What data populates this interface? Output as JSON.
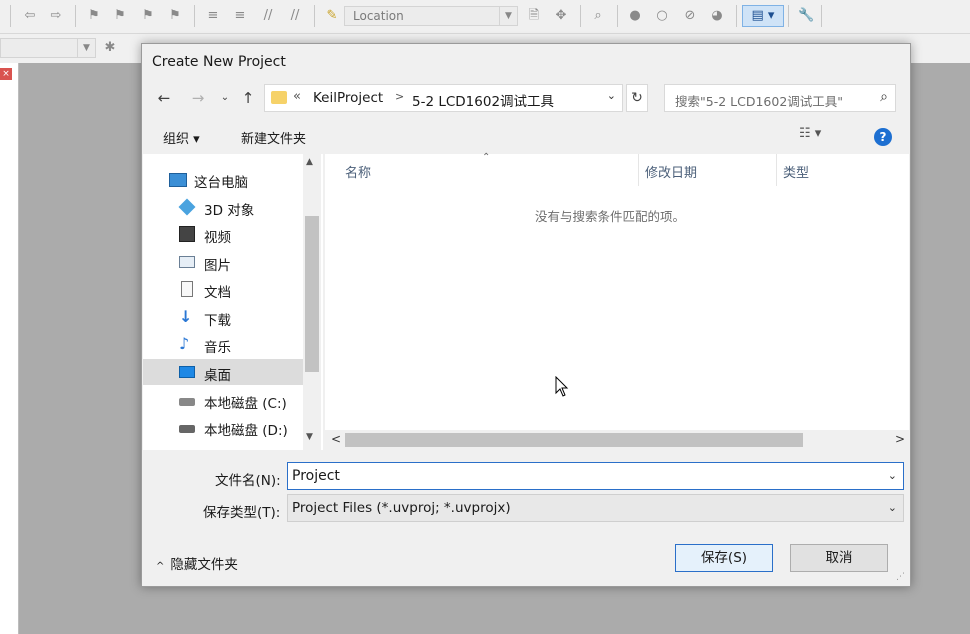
{
  "ide": {
    "location_placeholder": "Location"
  },
  "dialog": {
    "title": "Create New Project",
    "address": {
      "chevron": "«",
      "crumbs": [
        "KeilProject",
        "5-2 LCD1602调试工具"
      ]
    },
    "search_placeholder": "搜索\"5-2 LCD1602调试工具\"",
    "commands": {
      "organize": "组织 ▾",
      "new_folder": "新建文件夹"
    },
    "nav_items": [
      {
        "label": "这台电脑",
        "icon": "computer-icon"
      },
      {
        "label": "3D 对象",
        "icon": "3d-objects-icon"
      },
      {
        "label": "视频",
        "icon": "video-icon"
      },
      {
        "label": "图片",
        "icon": "pictures-icon"
      },
      {
        "label": "文档",
        "icon": "documents-icon"
      },
      {
        "label": "下载",
        "icon": "download-icon"
      },
      {
        "label": "音乐",
        "icon": "music-icon"
      },
      {
        "label": "桌面",
        "icon": "desktop-icon"
      },
      {
        "label": "本地磁盘 (C:)",
        "icon": "drive-icon"
      },
      {
        "label": "本地磁盘 (D:)",
        "icon": "drive-icon"
      }
    ],
    "columns": {
      "name": "名称",
      "date": "修改日期",
      "type": "类型"
    },
    "empty_message": "没有与搜索条件匹配的项。",
    "filename_label": "文件名(N):",
    "filename_value": "Project",
    "filetype_label": "保存类型(T):",
    "filetype_value": "Project Files (*.uvproj; *.uvprojx)",
    "hide_folders": "隐藏文件夹",
    "save_label": "保存(S)",
    "cancel_label": "取消"
  },
  "colors": {
    "accent": "#2a6fc9",
    "help": "#1d6fd1",
    "folder": "#f6d269",
    "selected_nav": "#dcdcdc"
  }
}
